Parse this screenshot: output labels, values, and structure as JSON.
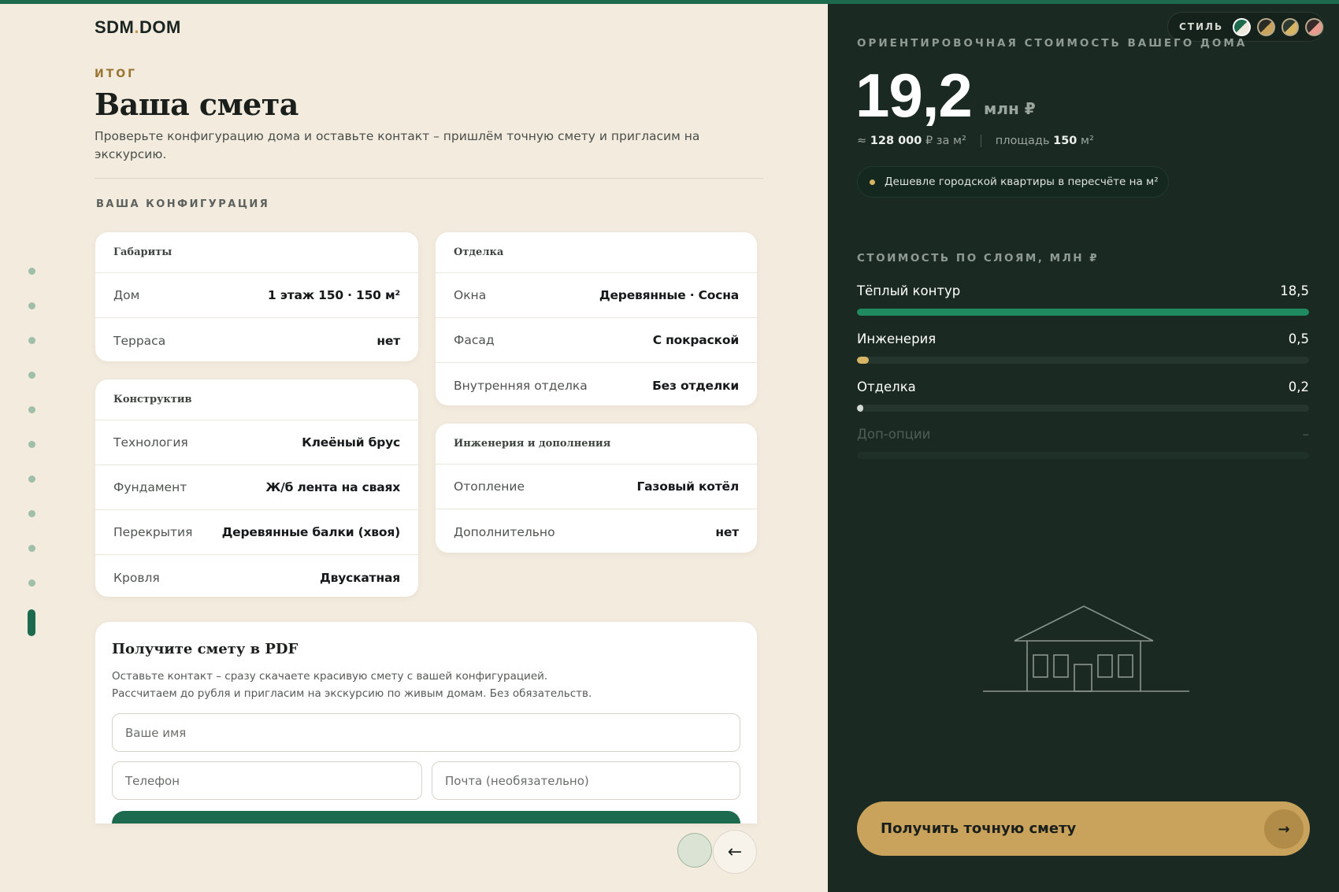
{
  "brand": {
    "name_main": "SDM",
    "name_dot": ".",
    "name_end": "DOM"
  },
  "header": {
    "eyebrow": "ИТОГ",
    "title": "Ваша смета",
    "description": "Проверьте конфигурацию дома и оставьте контакт – пришлём точную смету и пригласим на экскурсию.",
    "section_label": "ВАША КОНФИГУРАЦИЯ"
  },
  "steps": {
    "total": 11,
    "active_index": 10
  },
  "config": {
    "gabarity": {
      "title": "Габариты",
      "rows": [
        {
          "label": "Дом",
          "value": "1 этаж 150 · 150 м²"
        },
        {
          "label": "Терраса",
          "value": "нет"
        }
      ]
    },
    "konstruktiv": {
      "title": "Конструктив",
      "rows": [
        {
          "label": "Технология",
          "value": "Клеёный брус"
        },
        {
          "label": "Фундамент",
          "value": "Ж/б лента на сваях"
        },
        {
          "label": "Перекрытия",
          "value": "Деревянные балки (хвоя)"
        },
        {
          "label": "Кровля",
          "value": "Двускатная"
        }
      ]
    },
    "otdelka": {
      "title": "Отделка",
      "rows": [
        {
          "label": "Окна",
          "value": "Деревянные · Сосна"
        },
        {
          "label": "Фасад",
          "value": "С покраской"
        },
        {
          "label": "Внутренняя отделка",
          "value": "Без отделки"
        }
      ]
    },
    "inzheneriya": {
      "title": "Инженерия и дополнения",
      "rows": [
        {
          "label": "Отопление",
          "value": "Газовый котёл"
        },
        {
          "label": "Дополнительно",
          "value": "нет"
        }
      ]
    }
  },
  "pdf_form": {
    "title": "Получите смету в PDF",
    "line1": "Оставьте контакт – сразу скачаете красивую смету с вашей конфигурацией.",
    "line2": "Рассчитаем до рубля и пригласим на экскурсию по живым домам. Без обязательств.",
    "name_placeholder": "Ваше имя",
    "phone_placeholder": "Телефон",
    "email_placeholder": "Почта (необязательно)"
  },
  "nav": {
    "back_icon": "←"
  },
  "style_switcher": {
    "label": "СТИЛЬ",
    "options": [
      "green-cream",
      "dark-gold",
      "olive-gold",
      "rose"
    ]
  },
  "estimate": {
    "eyebrow": "ОРИЕНТИРОВОЧНАЯ СТОИМОСТЬ ВАШЕГО ДОМА",
    "amount": "19,2",
    "unit": "млн ₽",
    "per_m2_prefix": "≈",
    "per_m2_value": "128 000",
    "per_m2_suffix": "₽ за м²",
    "area_label": "площадь",
    "area_value": "150",
    "area_unit": "м²",
    "badge": "Дешевле городской квартиры в пересчёте на м²"
  },
  "layers": {
    "label": "СТОИМОСТЬ ПО СЛОЯМ, МЛН ₽",
    "items": [
      {
        "name": "Тёплый контур",
        "value": "18,5",
        "fraction": 1.0,
        "color": "#1f8a5f"
      },
      {
        "name": "Инженерия",
        "value": "0,5",
        "fraction": 0.027,
        "color": "#d6b564"
      },
      {
        "name": "Отделка",
        "value": "0,2",
        "fraction": 0.011,
        "color": "#d6dad5"
      },
      {
        "name": "Доп-опции",
        "value": "–",
        "fraction": 0,
        "color": "#4e5f56"
      }
    ]
  },
  "cta": {
    "label": "Получить точную смету",
    "arrow": "→"
  },
  "colors": {
    "accent_green": "#1d6b4f",
    "gold": "#c9a35c",
    "dark_bg": "#1a2a22",
    "cream_bg": "#f3ebde"
  }
}
